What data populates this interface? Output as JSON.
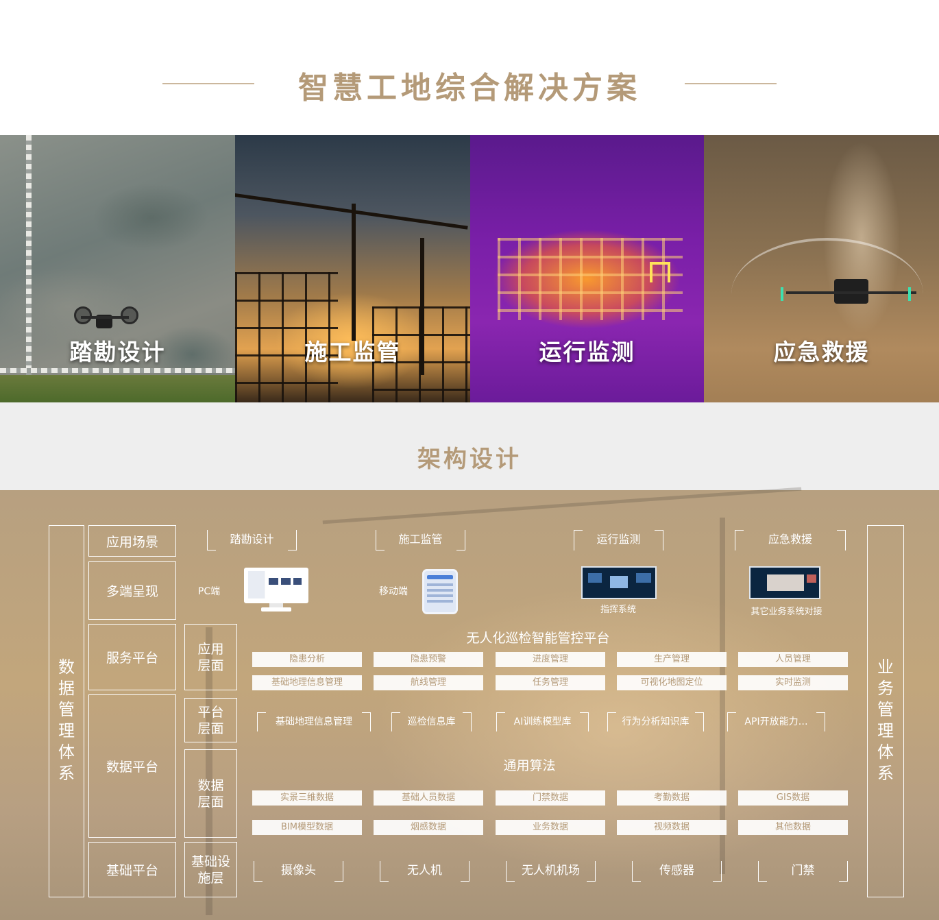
{
  "title": "智慧工地综合解决方案",
  "scenes": [
    "踏勘设计",
    "施工监管",
    "运行监测",
    "应急救援"
  ],
  "architecture": {
    "title": "架构设计",
    "left_system": "数据管理体系",
    "right_system": "业务管理体系",
    "rows": {
      "scenario": "应用场景",
      "multi_end": "多端呈现",
      "service": "服务平台",
      "data": "数据平台",
      "infra": "基础平台"
    },
    "layers": {
      "app": "应用层面",
      "platform": "平台层面",
      "data": "数据层面",
      "infra": "基础设施层"
    },
    "scenario_items": [
      "踏勘设计",
      "施工监管",
      "运行监测",
      "应急救援"
    ],
    "terminals": {
      "pc": "PC端",
      "mobile": "移动端",
      "command": "指挥系统",
      "other": "其它业务系统对接"
    },
    "platform_title": "无人化巡检智能管控平台",
    "app_row1": [
      "隐患分析",
      "隐患预警",
      "进度管理",
      "生产管理",
      "人员管理"
    ],
    "app_row2": [
      "基础地理信息管理",
      "航线管理",
      "任务管理",
      "可视化地图定位",
      "实时监测"
    ],
    "platform_items": [
      "基础地理信息管理",
      "巡检信息库",
      "AI训练模型库",
      "行为分析知识库",
      "API开放能力…"
    ],
    "algorithm_label": "通用算法",
    "data_row1": [
      "实景三维数据",
      "基础人员数据",
      "门禁数据",
      "考勤数据",
      "GIS数据"
    ],
    "data_row2": [
      "BIM模型数据",
      "烟感数据",
      "业务数据",
      "视频数据",
      "其他数据"
    ],
    "infra_items": [
      "摄像头",
      "无人机",
      "无人机机场",
      "传感器",
      "门禁"
    ]
  },
  "colors": {
    "accent": "#b49a78",
    "line": "#cbb79d",
    "panel": "#c2a67c",
    "chip_text": "#b49a78"
  }
}
